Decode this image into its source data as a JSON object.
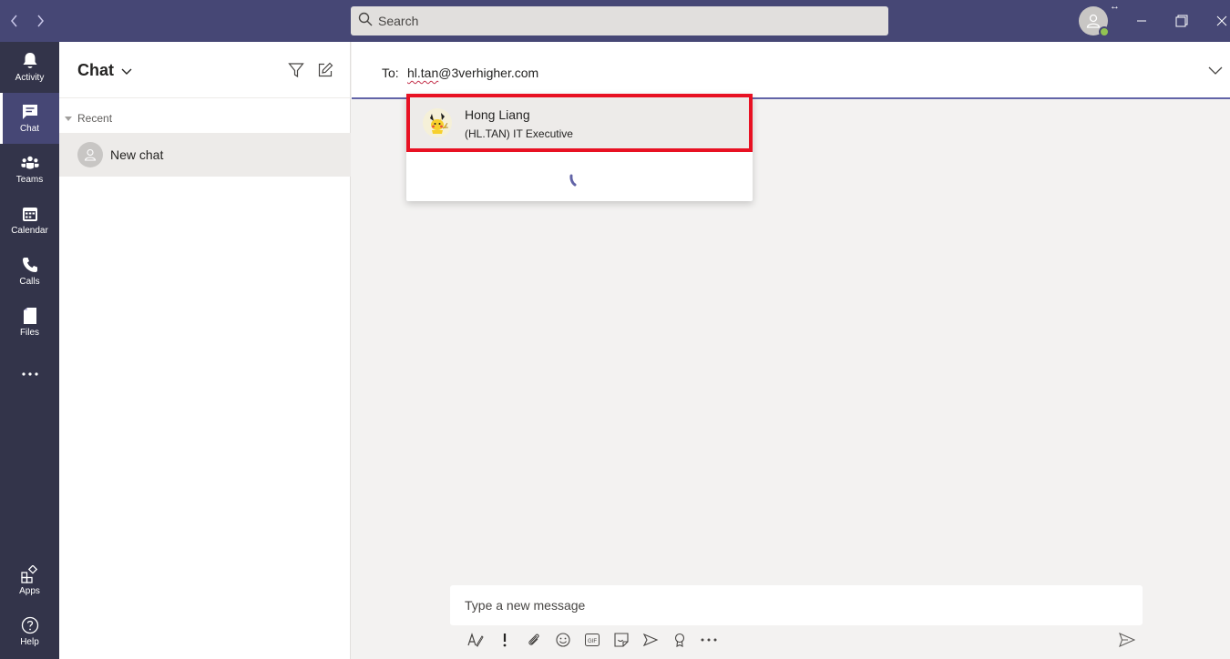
{
  "search": {
    "placeholder": "Search"
  },
  "rail": {
    "items": [
      {
        "label": "Activity",
        "icon": "bell-icon"
      },
      {
        "label": "Chat",
        "icon": "chat-icon",
        "active": true
      },
      {
        "label": "Teams",
        "icon": "teams-icon"
      },
      {
        "label": "Calendar",
        "icon": "calendar-icon"
      },
      {
        "label": "Calls",
        "icon": "phone-icon"
      },
      {
        "label": "Files",
        "icon": "file-icon"
      }
    ],
    "bottom": [
      {
        "label": "Apps",
        "icon": "apps-icon"
      },
      {
        "label": "Help",
        "icon": "help-icon"
      }
    ]
  },
  "list": {
    "title": "Chat",
    "section": "Recent",
    "rows": [
      {
        "label": "New chat"
      }
    ]
  },
  "to_bar": {
    "label": "To:",
    "value_prefix": "hl.tan",
    "value_suffix": "@3verhigher.com"
  },
  "suggestion": {
    "name": "Hong Liang",
    "subtitle": "(HL.TAN) IT Executive"
  },
  "compose": {
    "placeholder": "Type a new message"
  },
  "colors": {
    "titlebar": "#464775",
    "rail": "#33344a",
    "accent": "#6264a7",
    "highlight_border": "#e81123",
    "presence": "#92c353"
  }
}
